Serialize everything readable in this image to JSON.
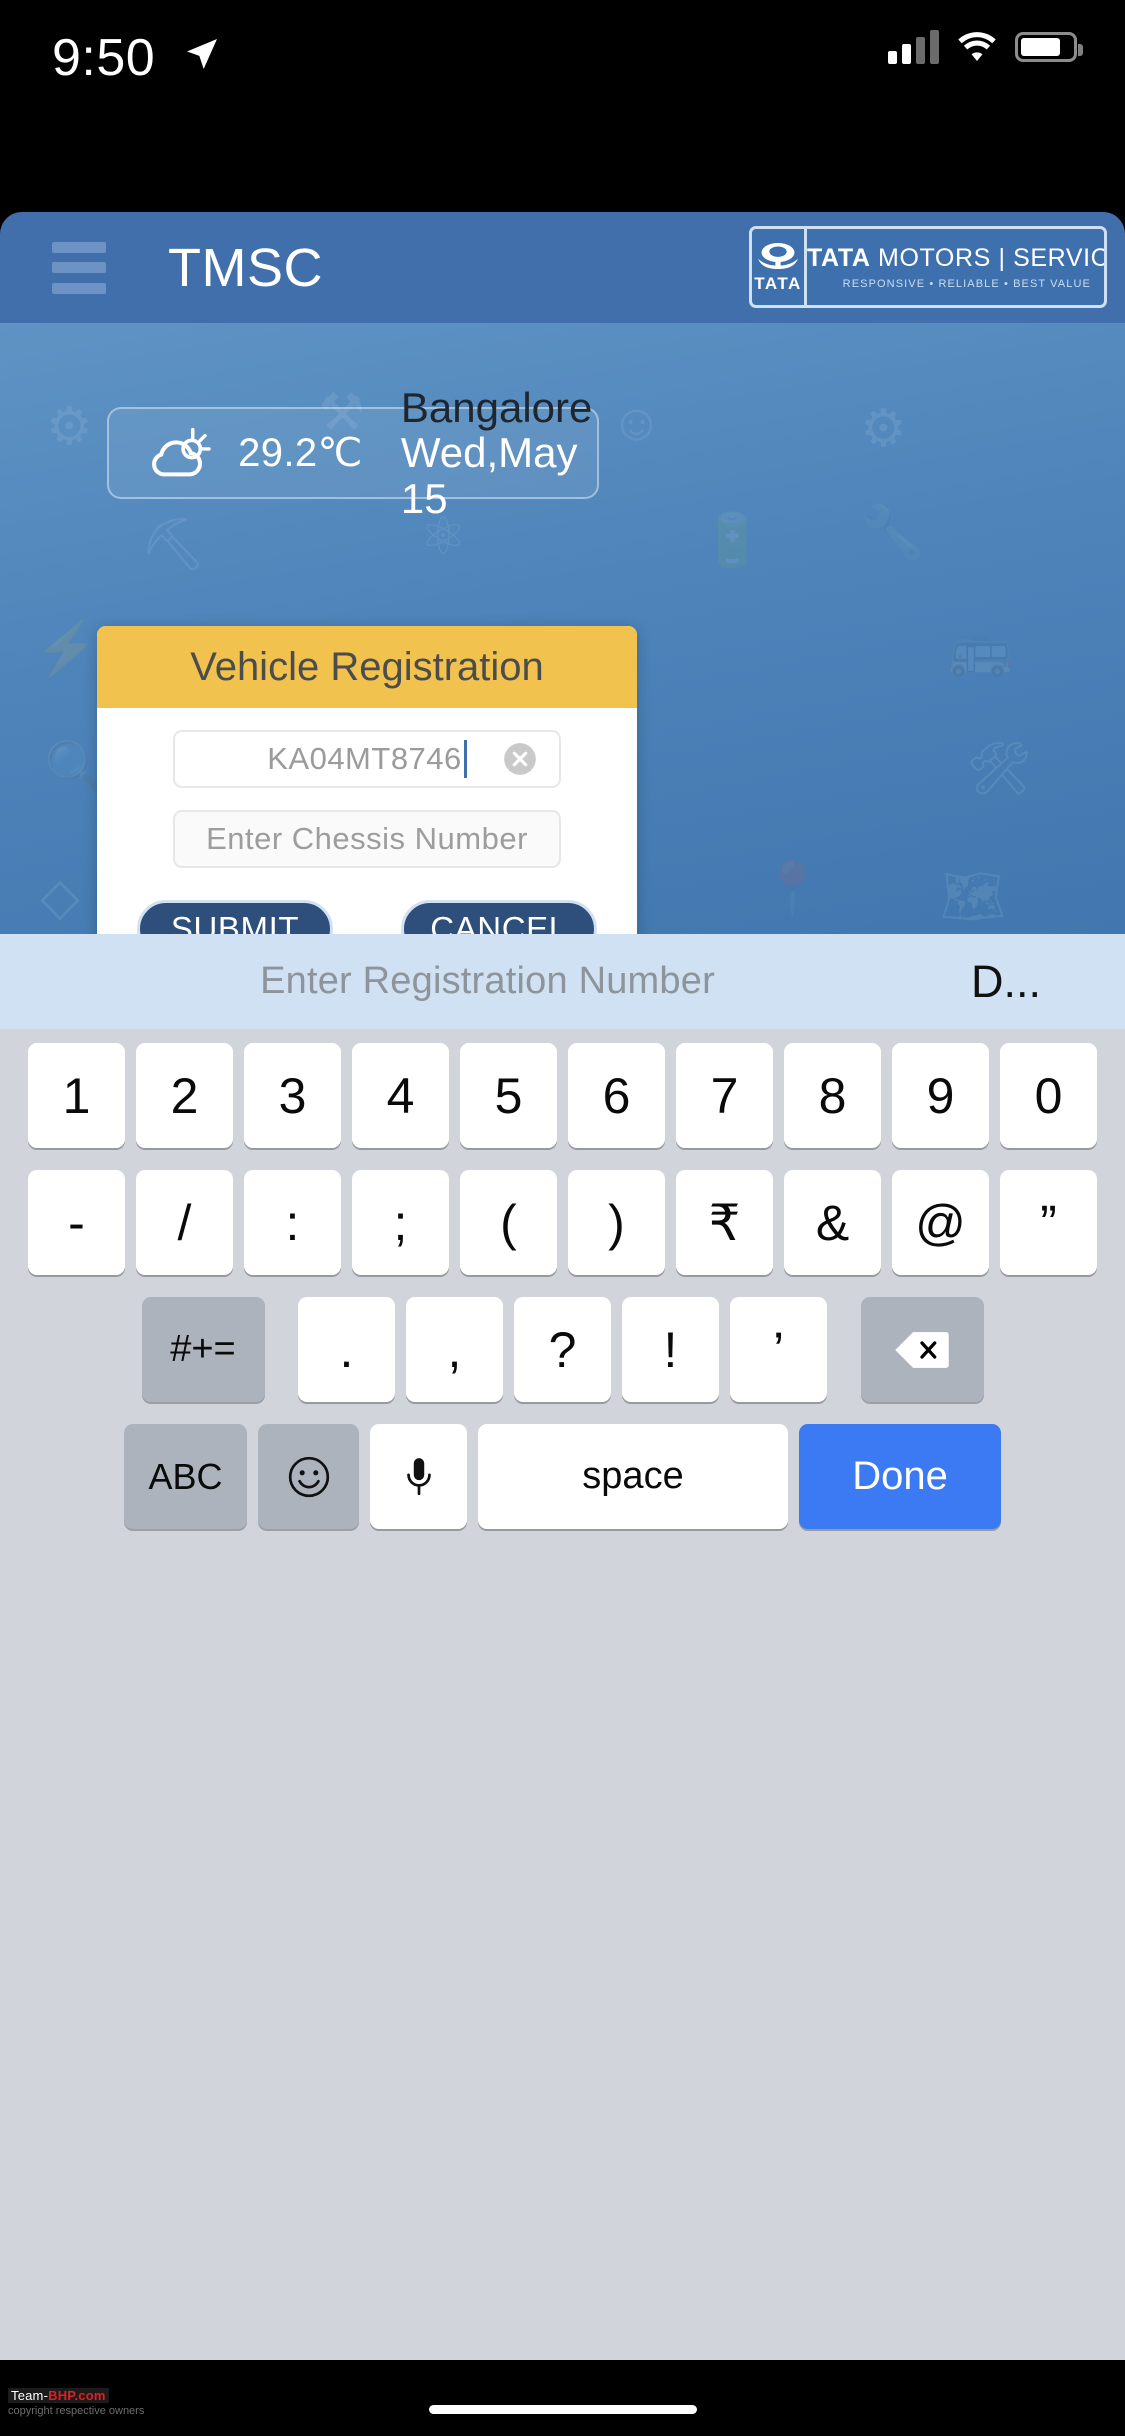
{
  "status_bar": {
    "time": "9:50",
    "location_icon": "location-arrow-icon",
    "signal_icon": "cellular-signal-icon",
    "wifi_icon": "wifi-icon",
    "battery_icon": "battery-icon"
  },
  "navbar": {
    "menu_icon": "hamburger-menu-icon",
    "title": "TMSC",
    "brand": {
      "mark_label": "TATA",
      "main_bold": "TATA",
      "main_rest": " MOTORS | SERVICE",
      "tagline": "RESPONSIVE • RELIABLE • BEST VALUE"
    }
  },
  "weather": {
    "icon": "partly-cloudy-icon",
    "temperature": "29.2℃",
    "city": "Bangalore",
    "date": "Wed,May 15"
  },
  "dialog": {
    "title": "Vehicle Registration",
    "registration_field": {
      "value": "KA04MT8746",
      "placeholder": "Enter Registration Number",
      "clear_icon": "clear-circle-icon"
    },
    "chassis_field": {
      "value": "",
      "placeholder": "Enter Chessis Number"
    },
    "submit_label": "SUBMIT",
    "cancel_label": "CANCEL"
  },
  "keyboard": {
    "predictive": {
      "suggestion": "Enter Registration Number",
      "alternate": "D..."
    },
    "row1": [
      "1",
      "2",
      "3",
      "4",
      "5",
      "6",
      "7",
      "8",
      "9",
      "0"
    ],
    "row2": [
      "-",
      "/",
      ":",
      ";",
      "(",
      ")",
      "₹",
      "&",
      "@",
      "”"
    ],
    "row3_left": "#+=",
    "row3": [
      ".",
      ",",
      "?",
      "!",
      "’"
    ],
    "row3_backspace_icon": "backspace-icon",
    "row4": {
      "abc": "ABC",
      "emoji_icon": "emoji-smiley-icon",
      "mic_icon": "microphone-icon",
      "space": "space",
      "done": "Done"
    }
  },
  "footer": {
    "watermark_brand": "Team-",
    "watermark_brand_red": "BHP.com",
    "watermark_copy": "copyright respective owners"
  },
  "colors": {
    "navbar_blue": "#416fac",
    "body_blue": "#4e84ba",
    "dialog_header_yellow": "#f2c24e",
    "button_navy": "#2e4f7b",
    "done_blue": "#3b7af2"
  }
}
